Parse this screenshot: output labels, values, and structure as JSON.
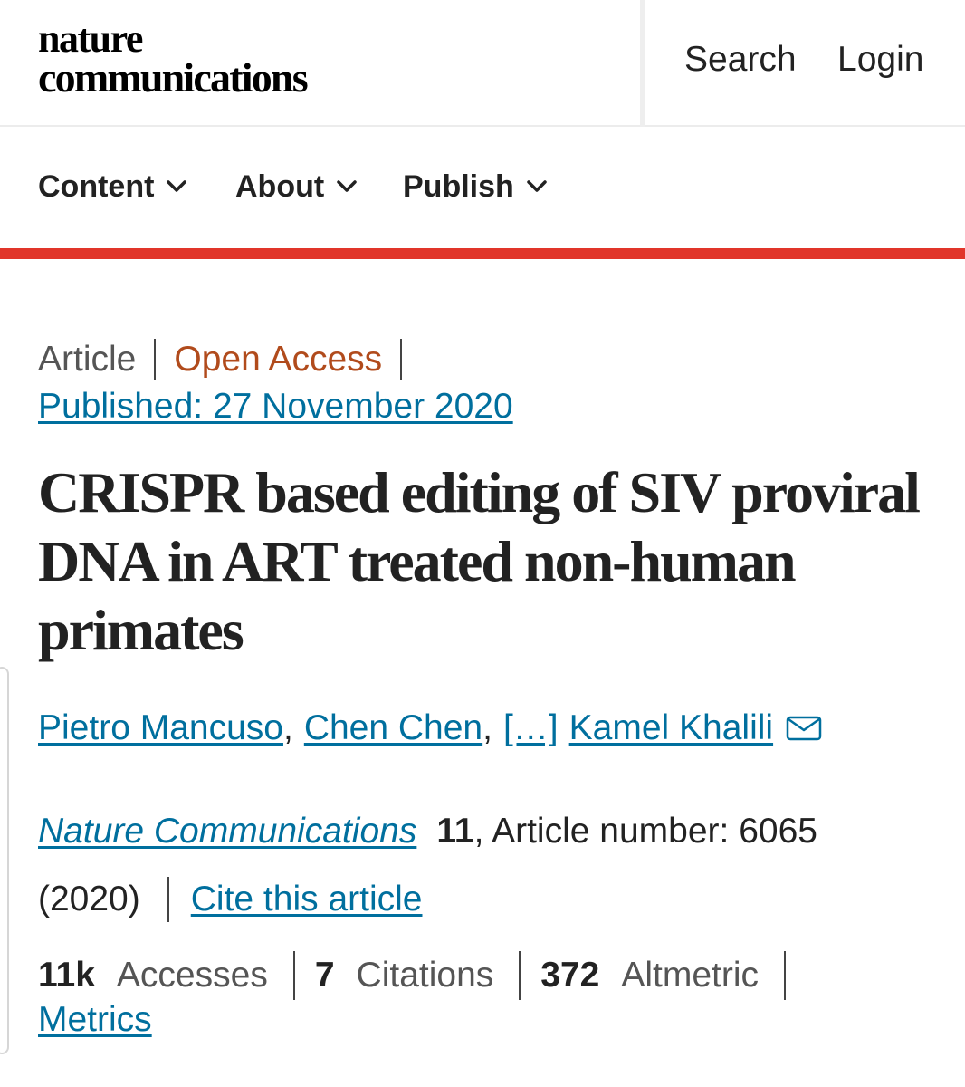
{
  "header": {
    "logo_line1": "nature",
    "logo_line2": "communications",
    "search_label": "Search",
    "login_label": "Login"
  },
  "nav": {
    "items": [
      {
        "label": "Content"
      },
      {
        "label": "About"
      },
      {
        "label": "Publish"
      }
    ]
  },
  "colors": {
    "accent_bar": "#e1352a",
    "link": "#006f9e",
    "open_access": "#b14b1c"
  },
  "article": {
    "type": "Article",
    "access": "Open Access",
    "published": "Published: 27 November 2020",
    "title": "CRISPR based editing of SIV proviral DNA in ART treated non-human primates",
    "authors": {
      "first": "Pietro Mancuso",
      "second": "Chen Chen",
      "ellipsis": "[…]",
      "last": "Kamel Khalili",
      "contact_icon": "mail-icon"
    },
    "citation": {
      "journal": "Nature Communications",
      "volume": "11",
      "article_number": ", Article number: 6065",
      "year": "(2020)",
      "cite_label": "Cite this article"
    },
    "metrics": {
      "accesses_value": "11k",
      "accesses_label": "Accesses",
      "citations_value": "7",
      "citations_label": "Citations",
      "altmetric_value": "372",
      "altmetric_label": "Altmetric",
      "metrics_link": "Metrics"
    }
  }
}
